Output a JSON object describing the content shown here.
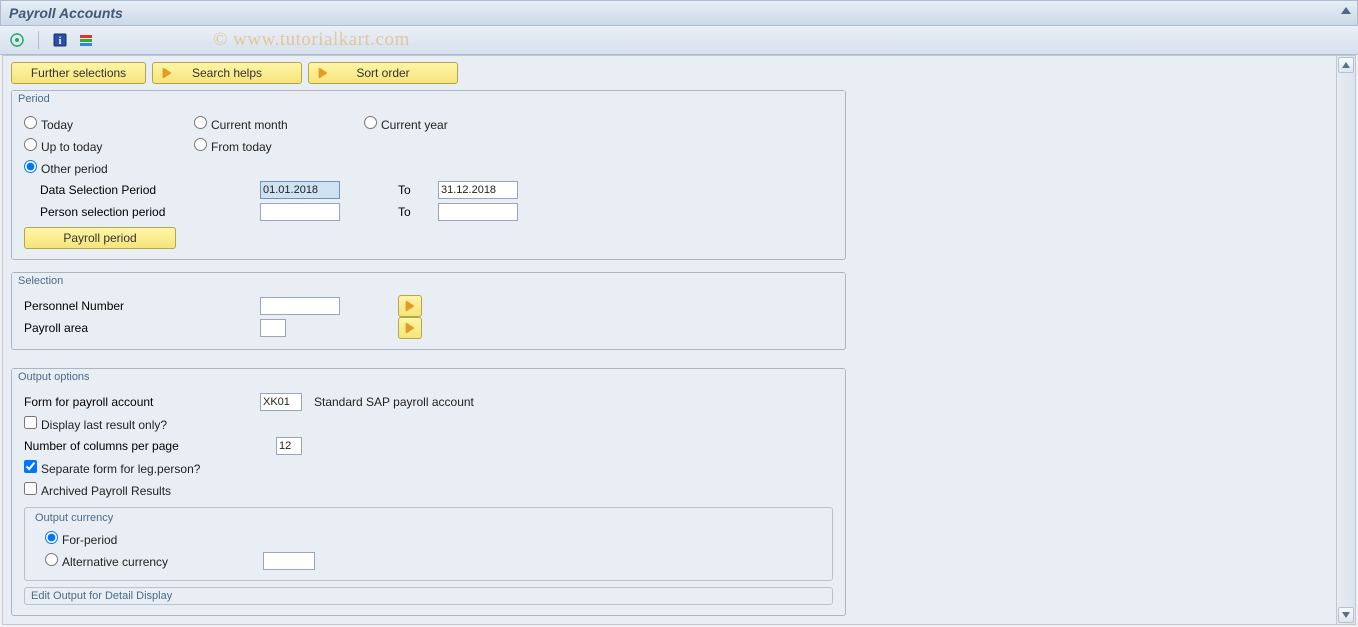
{
  "title": "Payroll Accounts",
  "watermark": "© www.tutorialkart.com",
  "buttons": {
    "further": "Further selections",
    "search": "Search helps",
    "sort": "Sort order"
  },
  "period": {
    "group_label": "Period",
    "radios": {
      "today": "Today",
      "current_month": "Current month",
      "current_year": "Current year",
      "up_to_today": "Up to today",
      "from_today": "From today",
      "other_period": "Other period"
    },
    "data_sel_label": "Data Selection Period",
    "data_sel_from": "01.01.2018",
    "to_label": "To",
    "data_sel_to": "31.12.2018",
    "person_sel_label": "Person selection period",
    "person_sel_from": "",
    "person_sel_to": "",
    "payroll_period_btn": "Payroll period"
  },
  "selection": {
    "group_label": "Selection",
    "pernr_label": "Personnel Number",
    "pernr_value": "",
    "area_label": "Payroll area",
    "area_value": ""
  },
  "output": {
    "group_label": "Output options",
    "form_label": "Form for payroll account",
    "form_value": "XK01",
    "form_desc": "Standard SAP payroll account",
    "disp_last_label": "Display last result only?",
    "cols_label": "Number of columns per page",
    "cols_value": "12",
    "sep_form_label": "Separate form for leg.person?",
    "archived_label": "Archived Payroll Results",
    "currency_group": "Output currency",
    "for_period": "For-period",
    "alt_currency": "Alternative currency",
    "alt_currency_value": "",
    "edit_output": "Edit Output for Detail Display"
  }
}
